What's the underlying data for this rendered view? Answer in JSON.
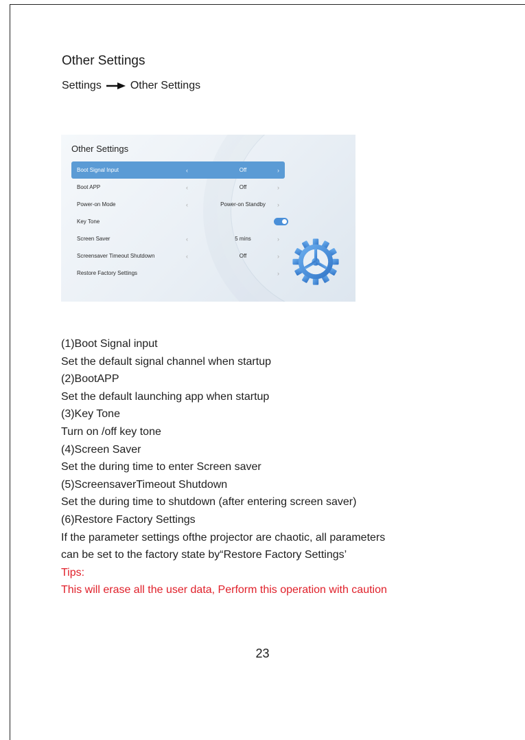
{
  "heading": "Other Settings",
  "breadcrumb": {
    "from": "Settings",
    "to": "Other Settings"
  },
  "screenshot": {
    "title": "Other Settings",
    "rows": [
      {
        "label": "Boot Signal Input",
        "value": "Off",
        "active": true
      },
      {
        "label": "Boot APP",
        "value": "Off"
      },
      {
        "label": "Power-on Mode",
        "value": "Power-on Standby"
      },
      {
        "label": "Key Tone",
        "value": "",
        "toggle": "on"
      },
      {
        "label": "Screen Saver",
        "value": "5 mins"
      },
      {
        "label": "Screensaver Timeout Shutdown",
        "value": "Off"
      },
      {
        "label": "Restore Factory Settings",
        "value": ""
      }
    ],
    "accent_color": "#5b9bd5",
    "gear_color": "#4a8fd8"
  },
  "lines": [
    "(1)Boot Signal input",
    "Set the default signal channel when startup",
    "(2)BootAPP",
    "Set the default launching app when startup",
    "(3)Key Tone",
    "Turn on /off key tone",
    "(4)Screen Saver",
    "Set the during time to enter Screen saver",
    "(5)ScreensaverTimeout Shutdown",
    "Set the during time to shutdown (after entering screen saver)",
    "(6)Restore Factory Settings",
    "If the parameter settings ofthe projector are chaotic, all parameters",
    "can be set to the factory state by“Restore Factory Settings’"
  ],
  "tips": {
    "label": "Tips:",
    "text": "This will erase all the user data, Perform this operation with caution",
    "color": "#e0202a"
  },
  "page_number": "23"
}
